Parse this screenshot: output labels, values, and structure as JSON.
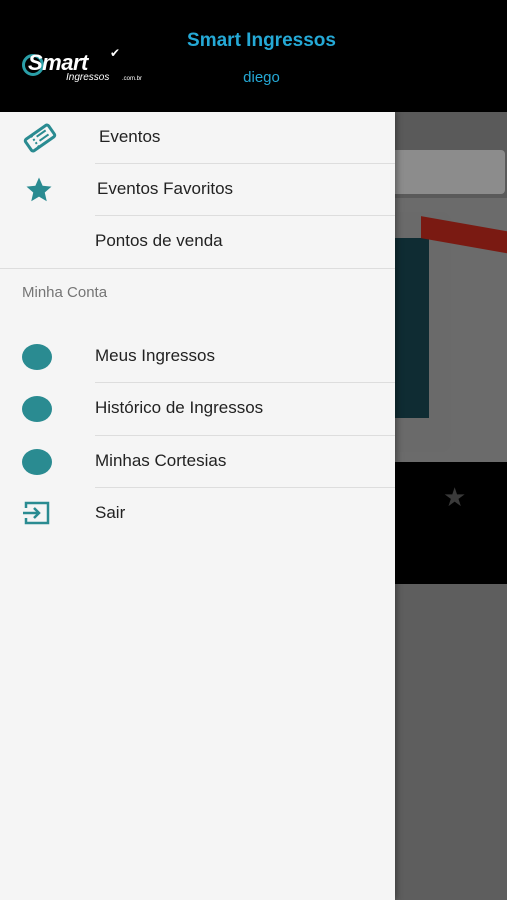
{
  "header": {
    "app_title": "Smart Ingressos",
    "user_name": "diego",
    "logo_word": "Smart",
    "logo_sub": "Ingressos",
    "logo_domain": ".com.br"
  },
  "drawer": {
    "main_items": [
      {
        "label": "Eventos",
        "icon": "ticket-icon"
      },
      {
        "label": "Eventos Favoritos",
        "icon": "star-icon"
      },
      {
        "label": "Pontos de venda",
        "icon": ""
      }
    ],
    "section_title": "Minha Conta",
    "account_items": [
      {
        "label": "Meus Ingressos",
        "icon": "circle-icon"
      },
      {
        "label": "Histórico de Ingressos",
        "icon": "circle-icon"
      },
      {
        "label": "Minhas Cortesias",
        "icon": "circle-icon"
      },
      {
        "label": "Sair",
        "icon": "logout-icon"
      }
    ]
  },
  "colors": {
    "accent": "#25a9d6",
    "icon_teal": "#2a8b91",
    "header_bg": "#000000",
    "drawer_bg": "#f5f5f5"
  }
}
